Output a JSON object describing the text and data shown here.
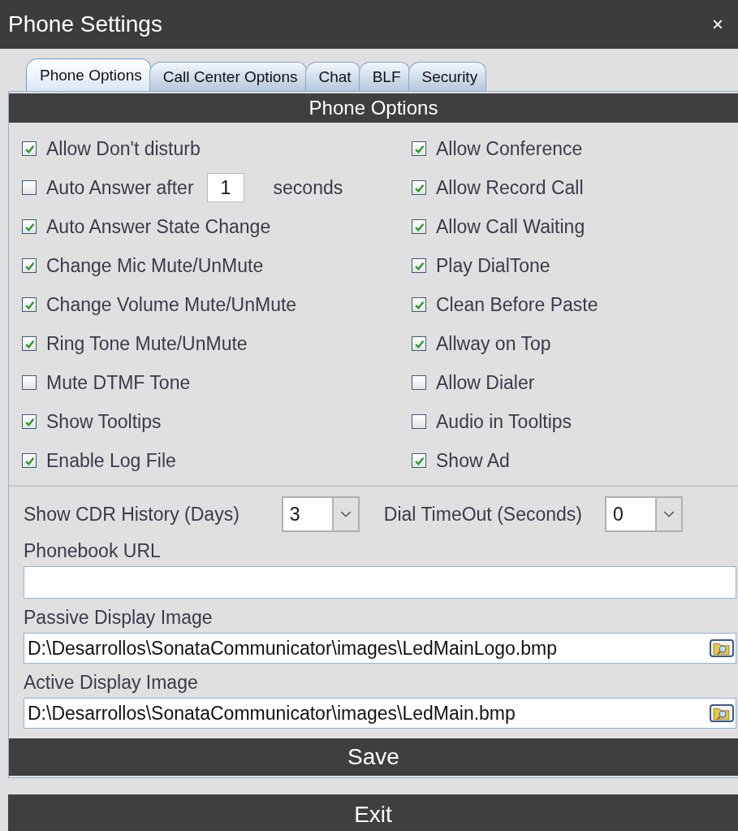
{
  "window": {
    "title": "Phone Settings",
    "close": "×"
  },
  "tabs": [
    {
      "label": "Phone Options",
      "selected": true
    },
    {
      "label": "Call Center Options",
      "selected": false
    },
    {
      "label": "Chat",
      "selected": false
    },
    {
      "label": "BLF",
      "selected": false
    },
    {
      "label": "Security",
      "selected": false
    }
  ],
  "section_title": "Phone Options",
  "left_options": [
    {
      "kind": "checkbox",
      "label": "Allow Don't disturb",
      "checked": true
    },
    {
      "kind": "checkbox-number",
      "label": "Auto Answer after",
      "checked": false,
      "value": "1",
      "suffix": "seconds"
    },
    {
      "kind": "checkbox",
      "label": "Auto Answer State Change",
      "checked": true
    },
    {
      "kind": "checkbox",
      "label": "Change Mic Mute/UnMute",
      "checked": true
    },
    {
      "kind": "checkbox",
      "label": "Change Volume Mute/UnMute",
      "checked": true
    },
    {
      "kind": "checkbox",
      "label": "Ring Tone Mute/UnMute",
      "checked": true
    },
    {
      "kind": "checkbox",
      "label": "Mute DTMF Tone",
      "checked": false
    },
    {
      "kind": "checkbox",
      "label": "Show Tooltips",
      "checked": true
    },
    {
      "kind": "checkbox",
      "label": "Enable Log File",
      "checked": true
    }
  ],
  "right_options": [
    {
      "label": "Allow Conference",
      "checked": true
    },
    {
      "label": "Allow Record Call",
      "checked": true
    },
    {
      "label": "Allow Call Waiting",
      "checked": true
    },
    {
      "label": "Play DialTone",
      "checked": true
    },
    {
      "label": "Clean Before Paste",
      "checked": true
    },
    {
      "label": "Allway on Top",
      "checked": true
    },
    {
      "label": "Allow Dialer",
      "checked": false
    },
    {
      "label": "Audio in Tooltips",
      "checked": false
    },
    {
      "label": "Show Ad",
      "checked": true
    }
  ],
  "cdr_history": {
    "label": "Show CDR History (Days)",
    "value": "3"
  },
  "dial_timeout": {
    "label": "Dial TimeOut (Seconds)",
    "value": "0"
  },
  "phonebook_url": {
    "label": "Phonebook URL"
  },
  "passive_image": {
    "label": "Passive Display Image",
    "value": "D:\\Desarrollos\\SonataCommunicator\\images\\LedMainLogo.bmp"
  },
  "active_image": {
    "label": "Active Display Image",
    "value": "D:\\Desarrollos\\SonataCommunicator\\images\\LedMain.bmp"
  },
  "buttons": [
    "Save",
    "Exit"
  ]
}
